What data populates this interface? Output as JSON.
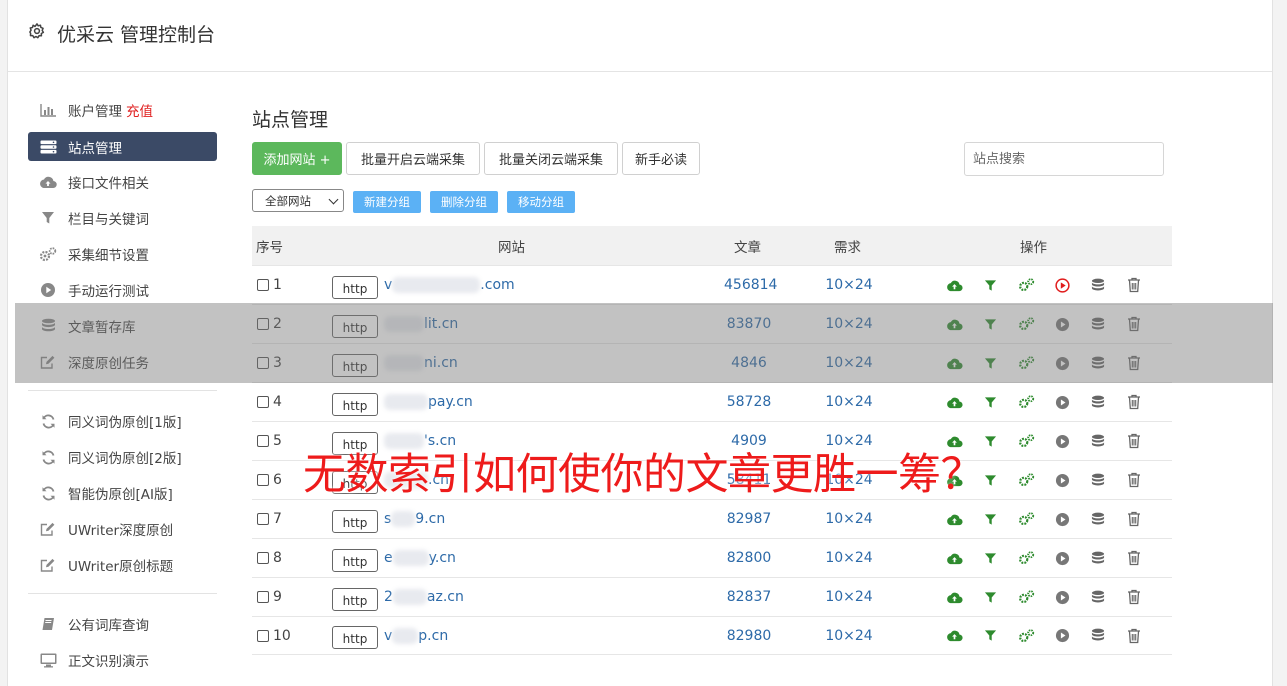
{
  "app": {
    "title": "优采云 管理控制台"
  },
  "sidebar": {
    "items": [
      {
        "label": "账户管理",
        "badge": "充值",
        "icon": "bar-chart-icon"
      },
      {
        "label": "站点管理",
        "icon": "server-icon",
        "active": true
      },
      {
        "label": "接口文件相关",
        "icon": "cloud-upload-icon"
      },
      {
        "label": "栏目与关键词",
        "icon": "filter-icon"
      },
      {
        "label": "采集细节设置",
        "icon": "cogs-icon"
      },
      {
        "label": "手动运行测试",
        "icon": "play-circle-icon"
      },
      {
        "label": "文章暂存库",
        "icon": "database-icon"
      },
      {
        "label": "深度原创任务",
        "icon": "edit-icon"
      }
    ],
    "group2": [
      {
        "label": "同义词伪原创[1版]",
        "icon": "refresh-icon"
      },
      {
        "label": "同义词伪原创[2版]",
        "icon": "refresh-icon"
      },
      {
        "label": "智能伪原创[AI版]",
        "icon": "refresh-icon"
      },
      {
        "label": "UWriter深度原创",
        "icon": "edit-icon"
      },
      {
        "label": "UWriter原创标题",
        "icon": "edit-icon"
      }
    ],
    "group3": [
      {
        "label": "公有词库查询",
        "icon": "book-icon"
      },
      {
        "label": "正文识别演示",
        "icon": "monitor-icon"
      }
    ]
  },
  "main": {
    "title": "站点管理",
    "buttons": {
      "add_site": "添加网站 +",
      "batch_open": "批量开启云端采集",
      "batch_close": "批量关闭云端采集",
      "newbie": "新手必读"
    },
    "search_placeholder": "站点搜索",
    "filter_select": "全部网站",
    "group_buttons": {
      "new": "新建分组",
      "delete": "删除分组",
      "move": "移动分组"
    },
    "table": {
      "headers": {
        "no": "序号",
        "site": "网站",
        "articles": "文章",
        "demand": "需求",
        "ops": "操作"
      },
      "rows": [
        {
          "no": "1",
          "proto": "http",
          "site_prefix": "v",
          "site_suffix": ".com",
          "articles": "456814",
          "demand": "10×24",
          "run_active": true
        },
        {
          "no": "2",
          "proto": "http",
          "site_prefix": "",
          "site_suffix": "lit.cn",
          "articles": "83870",
          "demand": "10×24",
          "run_active": false
        },
        {
          "no": "3",
          "proto": "http",
          "site_prefix": "",
          "site_suffix": "ni.cn",
          "articles": "4846",
          "demand": "10×24",
          "run_active": false
        },
        {
          "no": "4",
          "proto": "http",
          "site_prefix": "",
          "site_suffix": "pay.cn",
          "articles": "58728",
          "demand": "10×24",
          "run_active": false
        },
        {
          "no": "5",
          "proto": "http",
          "site_prefix": "",
          "site_suffix": "'s.cn",
          "articles": "4909",
          "demand": "10×24",
          "run_active": false
        },
        {
          "no": "6",
          "proto": "http",
          "site_prefix": "",
          "site_suffix": ".cn",
          "articles": "58411",
          "demand": "10×24",
          "run_active": false
        },
        {
          "no": "7",
          "proto": "http",
          "site_prefix": "s",
          "site_suffix": "9.cn",
          "articles": "82987",
          "demand": "10×24",
          "run_active": false
        },
        {
          "no": "8",
          "proto": "http",
          "site_prefix": "e",
          "site_suffix": "y.cn",
          "articles": "82800",
          "demand": "10×24",
          "run_active": false
        },
        {
          "no": "9",
          "proto": "http",
          "site_prefix": "2",
          "site_suffix": "az.cn",
          "articles": "82837",
          "demand": "10×24",
          "run_active": false
        },
        {
          "no": "10",
          "proto": "http",
          "site_prefix": "v",
          "site_suffix": "p.cn",
          "articles": "82980",
          "demand": "10×24",
          "run_active": false
        }
      ]
    }
  },
  "overlay_headline": "无数索引如何使你的文章更胜一筹？",
  "colors": {
    "sidebar_active": "#3b4a66",
    "add_button": "#5cb85c",
    "group_button": "#5bb1f5",
    "link": "#2d6aa8",
    "ops_green": "#2e8b2e",
    "run_red": "#e01c1c",
    "headline": "#ee1b1b"
  }
}
